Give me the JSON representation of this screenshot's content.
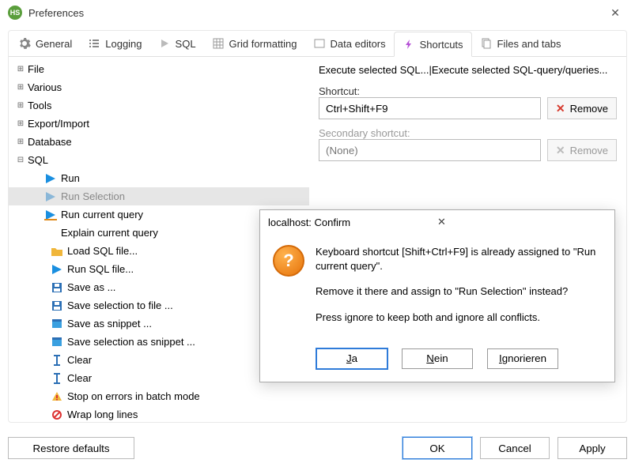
{
  "window": {
    "title": "Preferences"
  },
  "tabs": {
    "general": "General",
    "logging": "Logging",
    "sql": "SQL",
    "grid": "Grid formatting",
    "data_editors": "Data editors",
    "shortcuts": "Shortcuts",
    "files": "Files and tabs"
  },
  "tree": {
    "file": "File",
    "various": "Various",
    "tools": "Tools",
    "export_import": "Export/Import",
    "database": "Database",
    "sql": "SQL",
    "run": "Run",
    "run_selection": "Run Selection",
    "run_current_query": "Run current query",
    "explain_current_query": "Explain current query",
    "load_sql_file": "Load SQL file...",
    "run_sql_file": "Run SQL file...",
    "save_as": "Save as ...",
    "save_selection_to_file": "Save selection to file ...",
    "save_as_snippet": "Save as snippet ...",
    "save_selection_as_snippet": "Save selection as snippet ...",
    "clear1": "Clear",
    "clear2": "Clear",
    "stop_on_errors": "Stop on errors in batch mode",
    "wrap_long_lines": "Wrap long lines"
  },
  "detail": {
    "description": "Execute selected SQL...|Execute selected SQL-query/queries...",
    "shortcut_label": "Shortcut:",
    "shortcut_value": "Ctrl+Shift+F9",
    "secondary_label": "Secondary shortcut:",
    "secondary_value": "(None)",
    "remove": "Remove"
  },
  "footer": {
    "restore": "Restore defaults",
    "ok": "OK",
    "cancel": "Cancel",
    "apply": "Apply"
  },
  "modal": {
    "title": "localhost: Confirm",
    "line1": "Keyboard shortcut [Shift+Ctrl+F9] is already assigned to \"Run current query\".",
    "line2": "Remove it there and assign to \"Run Selection\" instead?",
    "line3": "Press ignore to keep both and ignore all conflicts.",
    "yes": "Ja",
    "no": "Nein",
    "ignore": "Ignorieren"
  }
}
